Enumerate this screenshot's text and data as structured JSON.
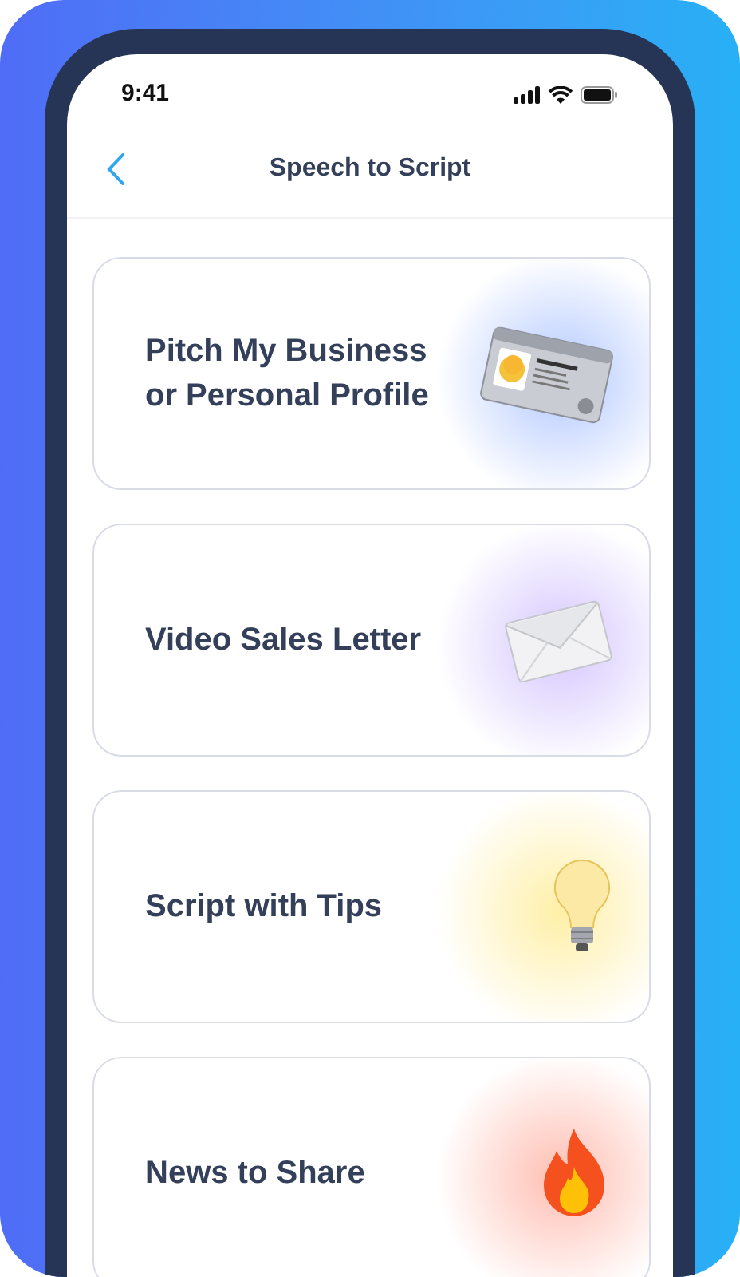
{
  "status_bar": {
    "time": "9:41"
  },
  "header": {
    "title": "Speech to Script"
  },
  "cards": [
    {
      "label": "Pitch My Business or Personal Profile",
      "kind": "idcard"
    },
    {
      "label": "Video Sales Letter",
      "kind": "envelope"
    },
    {
      "label": "Script with Tips",
      "kind": "bulb"
    },
    {
      "label": "News to Share",
      "kind": "fire"
    }
  ]
}
